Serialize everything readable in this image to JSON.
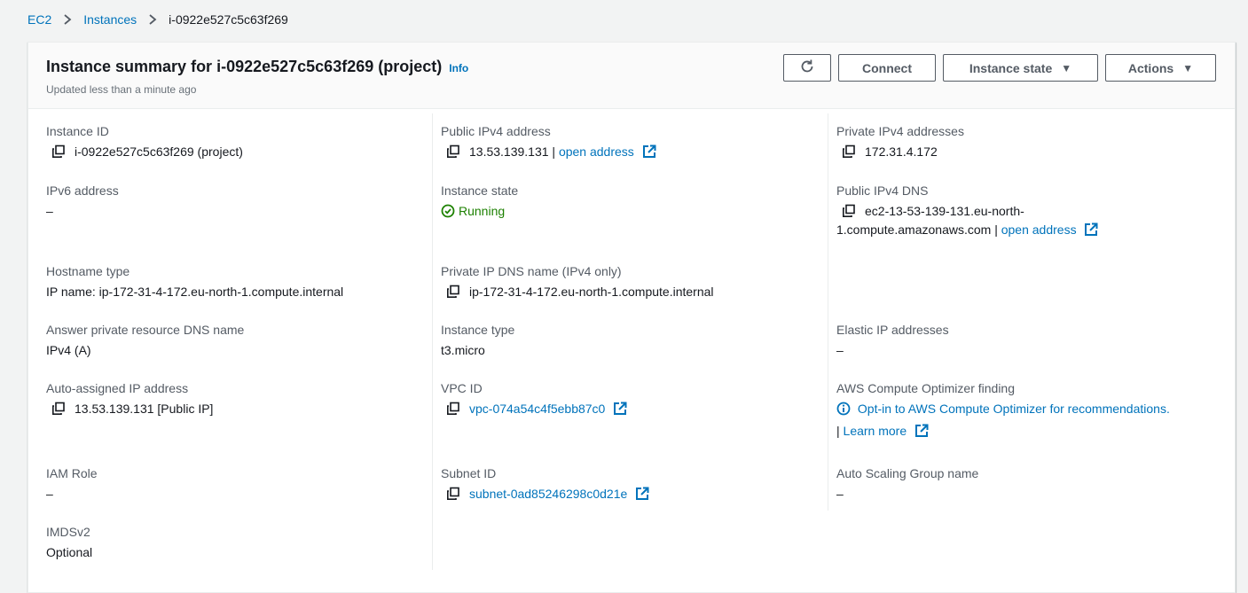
{
  "breadcrumb": {
    "ec2": "EC2",
    "instances": "Instances",
    "current": "i-0922e527c5c63f269"
  },
  "header": {
    "title": "Instance summary for i-0922e527c5c63f269 (project)",
    "info": "Info",
    "subtitle": "Updated less than a minute ago",
    "connect": "Connect",
    "instance_state": "Instance state",
    "actions": "Actions"
  },
  "fields": {
    "instance_id": {
      "label": "Instance ID",
      "value": "i-0922e527c5c63f269 (project)"
    },
    "public_ipv4": {
      "label": "Public IPv4 address",
      "value": "13.53.139.131 |",
      "link": "open address"
    },
    "private_ipv4": {
      "label": "Private IPv4 addresses",
      "value": "172.31.4.172"
    },
    "ipv6": {
      "label": "IPv6 address",
      "value": "–"
    },
    "instance_state": {
      "label": "Instance state",
      "value": "Running"
    },
    "public_dns": {
      "label": "Public IPv4 DNS",
      "value_line1": "ec2-13-53-139-131.eu-north-",
      "value_line2": "1.compute.amazonaws.com |",
      "link": "open address"
    },
    "hostname_type": {
      "label": "Hostname type",
      "value": "IP name: ip-172-31-4-172.eu-north-1.compute.internal"
    },
    "private_dns": {
      "label": "Private IP DNS name (IPv4 only)",
      "value": "ip-172-31-4-172.eu-north-1.compute.internal"
    },
    "answer_dns": {
      "label": "Answer private resource DNS name",
      "value": "IPv4 (A)"
    },
    "instance_type": {
      "label": "Instance type",
      "value": "t3.micro"
    },
    "elastic_ip": {
      "label": "Elastic IP addresses",
      "value": "–"
    },
    "auto_ip": {
      "label": "Auto-assigned IP address",
      "value": "13.53.139.131 [Public IP]"
    },
    "vpc_id": {
      "label": "VPC ID",
      "value": "vpc-074a54c4f5ebb87c0"
    },
    "optimizer": {
      "label": "AWS Compute Optimizer finding",
      "link": "Opt-in to AWS Compute Optimizer for recommendations.",
      "sep": "|",
      "learn_more": "Learn more"
    },
    "iam_role": {
      "label": "IAM Role",
      "value": "–"
    },
    "subnet_id": {
      "label": "Subnet ID",
      "value": "subnet-0ad85246298c0d21e"
    },
    "asg_name": {
      "label": "Auto Scaling Group name",
      "value": "–"
    },
    "imdsv2": {
      "label": "IMDSv2",
      "value": "Optional"
    }
  },
  "colors": {
    "link": "#0073bb",
    "running": "#1d8102",
    "label": "#545b64"
  }
}
